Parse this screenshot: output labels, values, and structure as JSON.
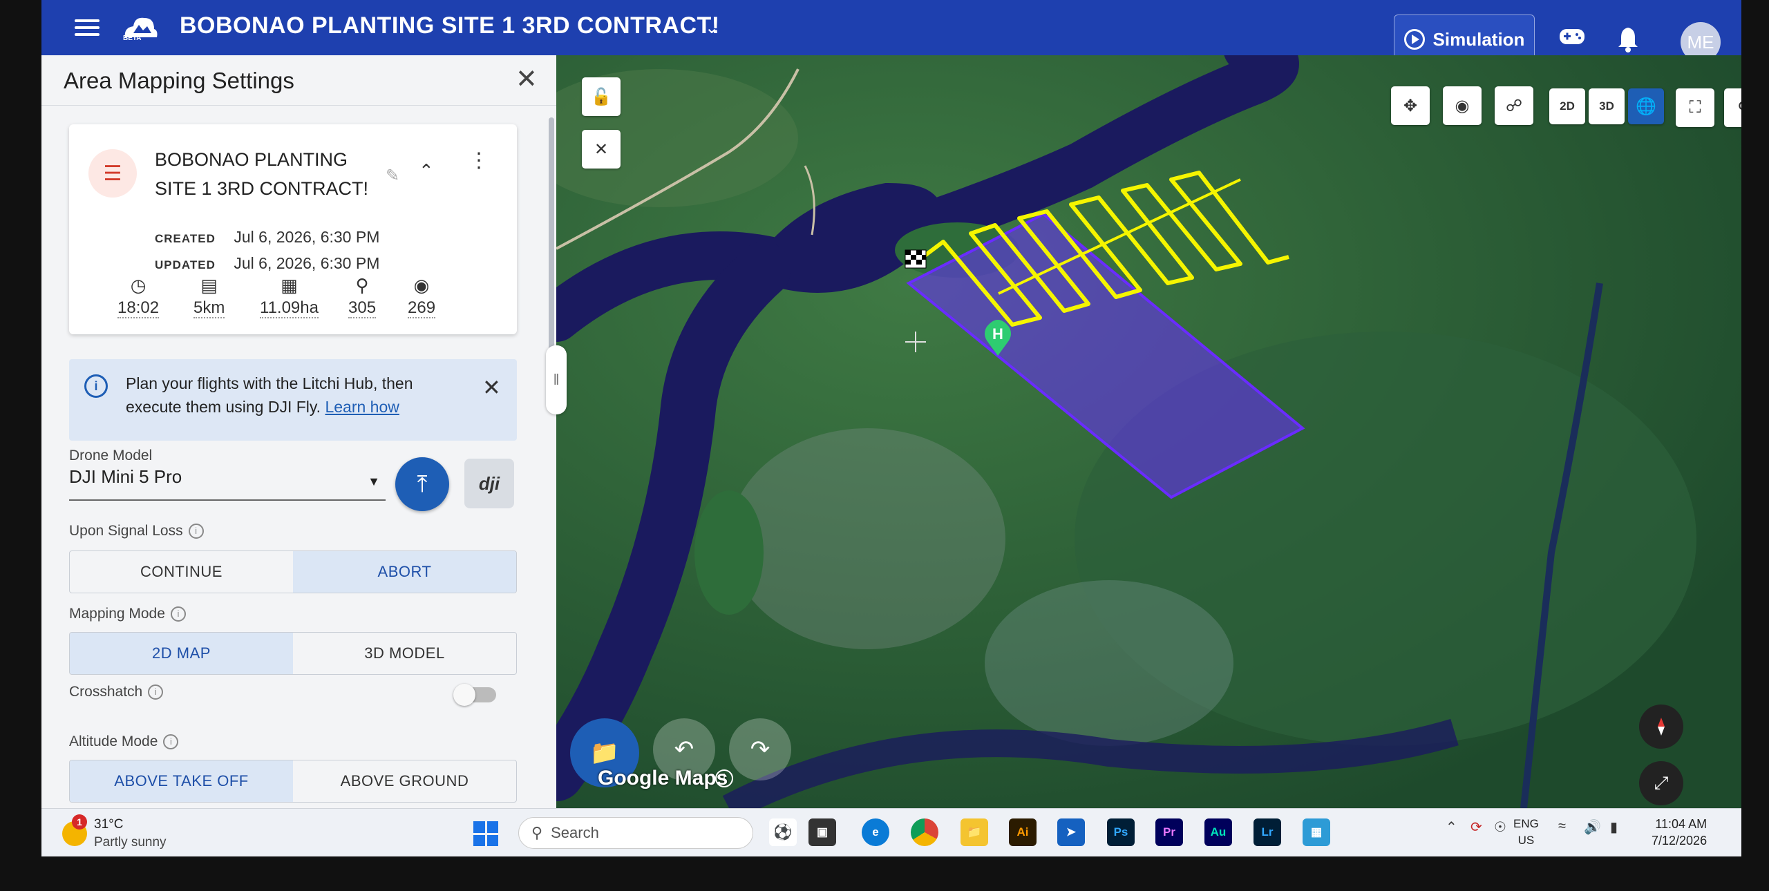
{
  "app": {
    "beta_label": "BETA",
    "project_title": "BOBONAO PLANTING SITE 1 3RD CONTRACT!",
    "simulation_label": "Simulation",
    "avatar_initials": "ME"
  },
  "panel": {
    "title": "Area Mapping Settings",
    "mission": {
      "name_line1": "BOBONAO PLANTING",
      "name_line2": "SITE 1 3RD CONTRACT!",
      "created_label": "CREATED",
      "created_value": "Jul 6, 2026, 6:30 PM",
      "updated_label": "UPDATED",
      "updated_value": "Jul 6, 2026, 6:30 PM",
      "stats": {
        "time": "18:02",
        "distance": "5km",
        "area": "11.09ha",
        "waypoints": "305",
        "photos": "269"
      }
    },
    "info": {
      "text": "Plan your flights with the Litchi Hub, then execute them using DJI Fly.",
      "link": "Learn how"
    },
    "drone_model_label": "Drone Model",
    "drone_model_value": "DJI Mini 5 Pro",
    "dji_label": "dji",
    "signal_loss": {
      "label": "Upon Signal Loss",
      "options": [
        "CONTINUE",
        "ABORT"
      ],
      "selected": "ABORT"
    },
    "mapping_mode": {
      "label": "Mapping Mode",
      "options": [
        "2D MAP",
        "3D MODEL"
      ],
      "selected": "2D MAP"
    },
    "crosshatch": {
      "label": "Crosshatch",
      "enabled": false
    },
    "altitude_mode": {
      "label": "Altitude Mode",
      "options": [
        "ABOVE TAKE OFF",
        "ABOVE GROUND"
      ],
      "selected": "ABOVE TAKE OFF"
    }
  },
  "map": {
    "view_buttons": [
      "2D",
      "3D"
    ],
    "attribution": "Google Maps",
    "home_marker_label": "H",
    "colors": {
      "flight_path": "#f5f500",
      "area_polygon": "#6a2cff",
      "home_marker": "#2ecc71",
      "accent": "#1e5eb5"
    }
  },
  "taskbar": {
    "weather_badge": "1",
    "temperature": "31°C",
    "weather_desc": "Partly sunny",
    "search_placeholder": "Search",
    "apps": [
      "Ai",
      "Ps",
      "Pr",
      "Au",
      "Lr"
    ],
    "lang_line1": "ENG",
    "lang_line2": "US",
    "time": "11:04 AM",
    "date": "7/12/2026"
  }
}
